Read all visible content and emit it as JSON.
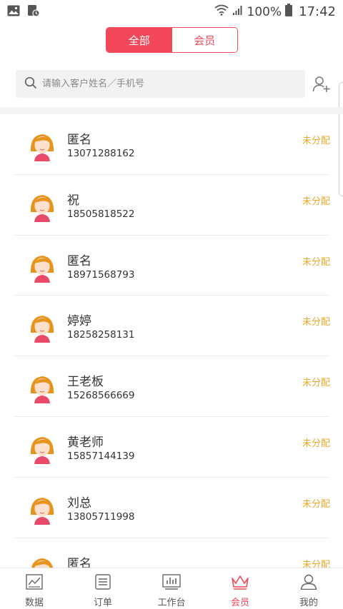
{
  "status_bar": {
    "left_icons": [
      "image-icon",
      "download-status-icon"
    ],
    "battery_pct": "100%",
    "time": "17:42"
  },
  "tabs": [
    {
      "label": "全部",
      "active": true
    },
    {
      "label": "会员",
      "active": false
    }
  ],
  "search": {
    "placeholder": "请输入客户姓名／手机号"
  },
  "customers": [
    {
      "name": "匿名",
      "phone": "13071288162",
      "status": "未分配"
    },
    {
      "name": "祝",
      "phone": "18505818522",
      "status": "未分配"
    },
    {
      "name": "匿名",
      "phone": "18971568793",
      "status": "未分配"
    },
    {
      "name": "婷婷",
      "phone": "18258258131",
      "status": "未分配"
    },
    {
      "name": "王老板",
      "phone": "15268566669",
      "status": "未分配"
    },
    {
      "name": "黄老师",
      "phone": "15857144139",
      "status": "未分配"
    },
    {
      "name": "刘总",
      "phone": "13805711998",
      "status": "未分配"
    },
    {
      "name": "匿名",
      "phone": "",
      "status": "未分配"
    }
  ],
  "bottom_nav": [
    {
      "label": "数据",
      "icon": "chart-icon",
      "active": false
    },
    {
      "label": "订单",
      "icon": "order-list-icon",
      "active": false
    },
    {
      "label": "工作台",
      "icon": "workbench-icon",
      "active": false
    },
    {
      "label": "会员",
      "icon": "crown-icon",
      "active": true
    },
    {
      "label": "我的",
      "icon": "person-icon",
      "active": false
    }
  ],
  "colors": {
    "accent": "#f2485a",
    "status": "#e9a829"
  }
}
